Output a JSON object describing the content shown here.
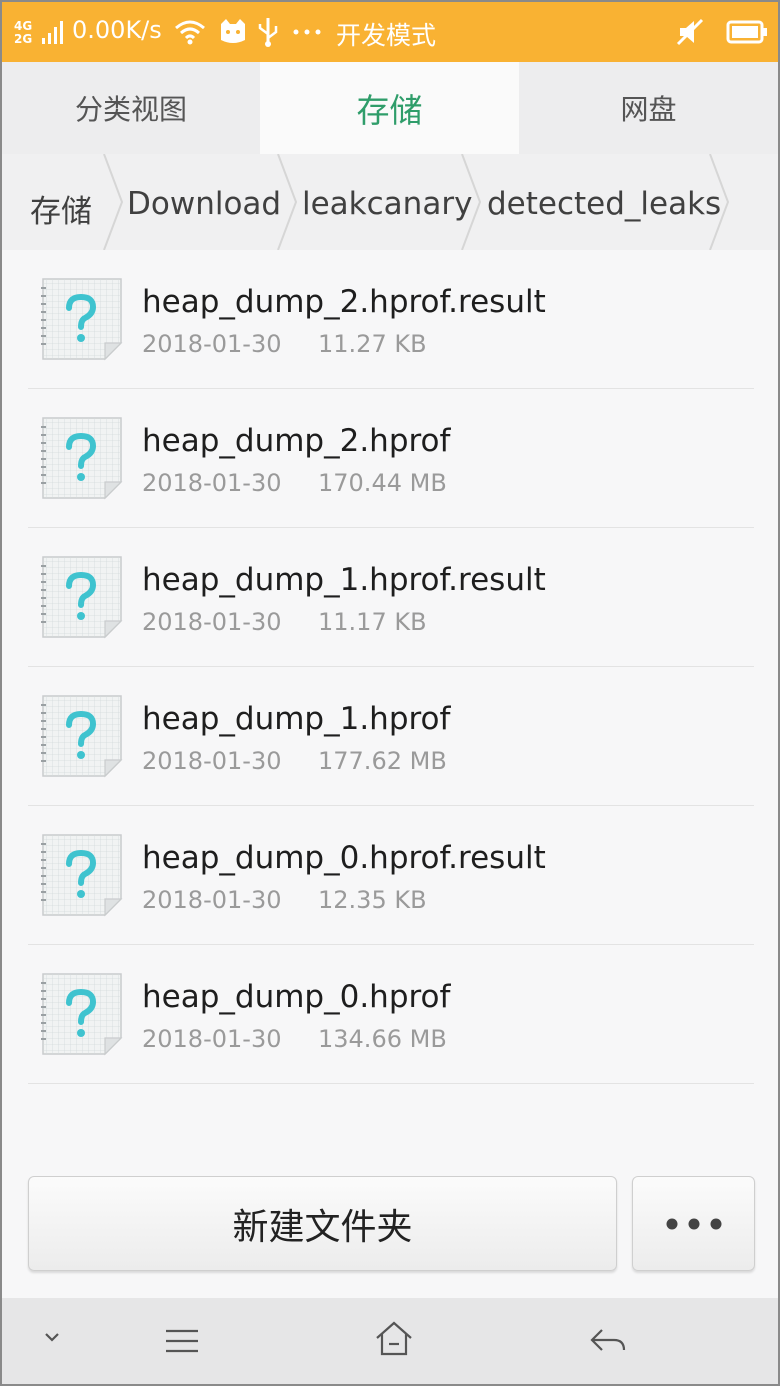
{
  "status_bar": {
    "network_top": "4G",
    "network_bottom": "2G",
    "speed": "0.00K/s",
    "mode": "开发模式",
    "icons": [
      "signal-icon",
      "wifi-icon",
      "cat-icon",
      "usb-icon",
      "more-dots-icon",
      "mute-icon",
      "battery-icon"
    ]
  },
  "tabs": [
    {
      "label": "分类视图",
      "active": false
    },
    {
      "label": "存储",
      "active": true
    },
    {
      "label": "网盘",
      "active": false
    }
  ],
  "breadcrumb": [
    "存储",
    "Download",
    "leakcanary",
    "detected_leaks"
  ],
  "files": [
    {
      "name": "heap_dump_2.hprof.result",
      "date": "2018-01-30",
      "size": "11.27 KB",
      "icon": "unknown-file-icon"
    },
    {
      "name": "heap_dump_2.hprof",
      "date": "2018-01-30",
      "size": "170.44 MB",
      "icon": "unknown-file-icon"
    },
    {
      "name": "heap_dump_1.hprof.result",
      "date": "2018-01-30",
      "size": "11.17 KB",
      "icon": "unknown-file-icon"
    },
    {
      "name": "heap_dump_1.hprof",
      "date": "2018-01-30",
      "size": "177.62 MB",
      "icon": "unknown-file-icon"
    },
    {
      "name": "heap_dump_0.hprof.result",
      "date": "2018-01-30",
      "size": "12.35 KB",
      "icon": "unknown-file-icon"
    },
    {
      "name": "heap_dump_0.hprof",
      "date": "2018-01-30",
      "size": "134.66 MB",
      "icon": "unknown-file-icon"
    }
  ],
  "actions": {
    "new_folder": "新建文件夹",
    "more_icon": "more-dots-icon"
  },
  "nav_bar": {
    "icons": [
      "chevron-down-icon",
      "menu-icon",
      "home-icon",
      "back-icon"
    ]
  },
  "colors": {
    "status_bar": "#f9b233",
    "active_tab": "#2f9d6a",
    "file_icon_accent": "#3fc3cf"
  }
}
